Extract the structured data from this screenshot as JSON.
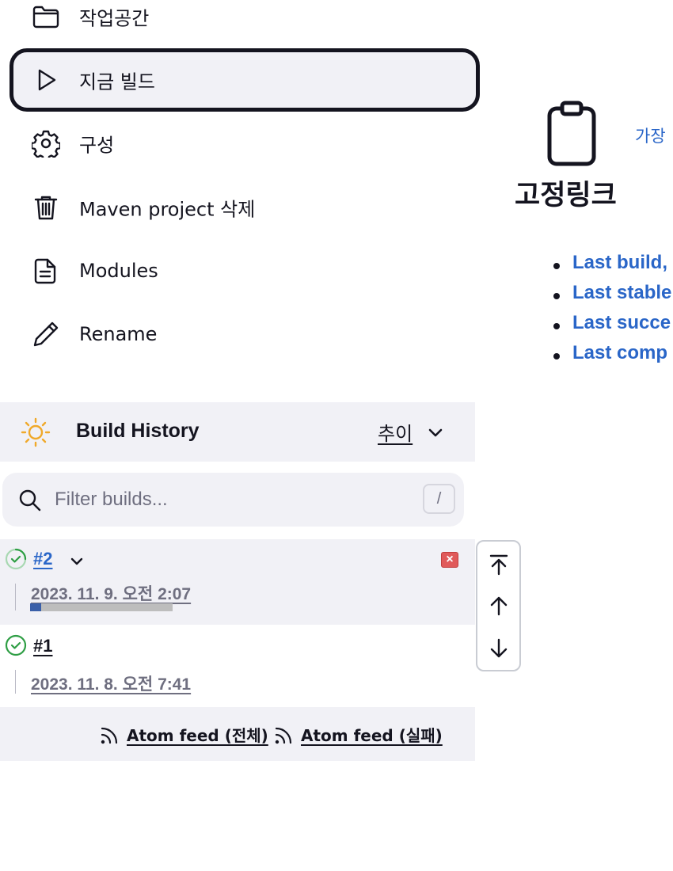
{
  "side_menu": {
    "items": [
      {
        "label": "작업공간",
        "icon": "folder-icon"
      },
      {
        "label": "지금 빌드",
        "icon": "play-icon"
      },
      {
        "label": "구성",
        "icon": "gear-icon"
      },
      {
        "label": "Maven project 삭제",
        "icon": "trash-icon"
      },
      {
        "label": "Modules",
        "icon": "document-icon"
      },
      {
        "label": "Rename",
        "icon": "pencil-icon"
      }
    ]
  },
  "build_history": {
    "title": "Build History",
    "trend_label": "추이",
    "filter_placeholder": "Filter builds...",
    "filter_shortcut": "/",
    "builds": [
      {
        "number": "#2",
        "date": "2023. 11. 9. 오전 2:07",
        "status": "success",
        "in_progress": true,
        "progress": 0.08
      },
      {
        "number": "#1",
        "date": "2023. 11. 8. 오전 7:41",
        "status": "success",
        "in_progress": false
      }
    ],
    "feeds": {
      "all": "Atom feed (전체)",
      "failures": "Atom feed (실패)"
    }
  },
  "scroll_controls": [
    "scroll-to-top",
    "scroll-up",
    "scroll-down"
  ],
  "permalinks": {
    "recent_label": "가장",
    "title": "고정링크",
    "items": [
      "Last build,",
      "Last stable",
      "Last succe",
      "Last comp"
    ]
  },
  "colors": {
    "accent_link": "#2a66c8",
    "panel_bg": "#f1f1f6",
    "success_green": "#2e9e44",
    "progress_fill": "#3a5fa8",
    "cancel_red": "#e05a5a"
  }
}
